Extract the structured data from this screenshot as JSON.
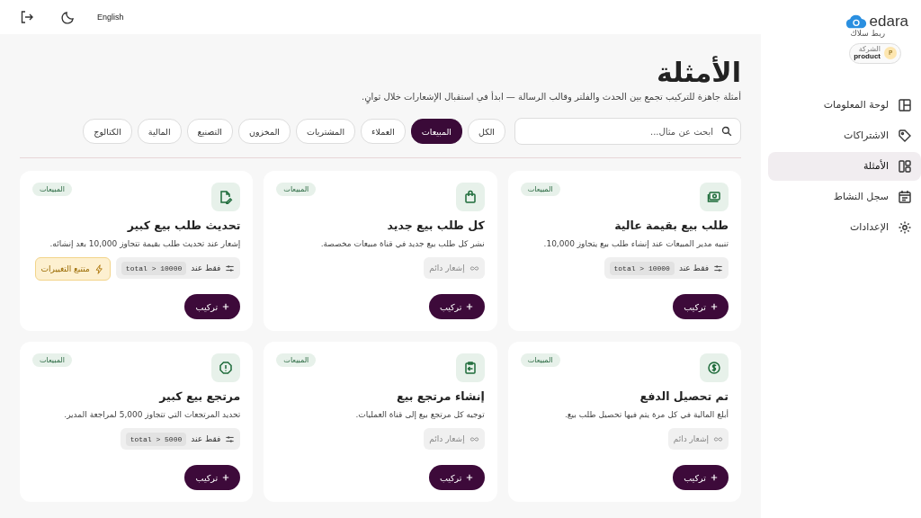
{
  "topbar": {
    "language": "English"
  },
  "brand": {
    "name": "edara",
    "subtitle": "ربط سلاك"
  },
  "company": {
    "label": "الشركة",
    "name": "product",
    "initial": "P"
  },
  "sidebar": {
    "items": [
      {
        "label": "لوحة المعلومات",
        "selected": false
      },
      {
        "label": "الاشتراكات",
        "selected": false
      },
      {
        "label": "الأمثلة",
        "selected": true
      },
      {
        "label": "سجل النشاط",
        "selected": false
      },
      {
        "label": "الإعدادات",
        "selected": false
      }
    ]
  },
  "page": {
    "title": "الأمثلة",
    "subtitle": "أمثلة جاهزة للتركيب تجمع بين الحدث والفلتر وقالب الرسالة — ابدأ في استقبال الإشعارات خلال ثوانٍ."
  },
  "search": {
    "placeholder": "ابحث عن مثال..."
  },
  "filters": [
    {
      "label": "الكل",
      "selected": false
    },
    {
      "label": "المبيعات",
      "selected": true
    },
    {
      "label": "العملاء",
      "selected": false
    },
    {
      "label": "المشتريات",
      "selected": false
    },
    {
      "label": "المخزون",
      "selected": false
    },
    {
      "label": "التصنيع",
      "selected": false
    },
    {
      "label": "المالية",
      "selected": false
    },
    {
      "label": "الكتالوج",
      "selected": false
    }
  ],
  "cards": [
    {
      "tag": "المبيعات",
      "title": "طلب بيع بقيمة عالية",
      "description": "تنبيه مدير المبيعات عند إنشاء طلب بيع يتجاوز 10,000.",
      "filter": {
        "kind": "condition",
        "label": "فقط عند",
        "code": "total > 10000"
      },
      "button": "تركيب"
    },
    {
      "tag": "المبيعات",
      "title": "كل طلب بيع جديد",
      "description": "نشر كل طلب بيع جديد في قناة مبيعات مخصصة.",
      "filter": {
        "kind": "always",
        "label": "إشعار دائم"
      },
      "button": "تركيب"
    },
    {
      "tag": "المبيعات",
      "title": "تحديث طلب بيع كبير",
      "description": "إشعار عند تحديث طلب بقيمة تتجاوز 10,000 بعد إنشائه.",
      "filter": {
        "kind": "condition",
        "label": "فقط عند",
        "code": "total > 10000"
      },
      "track_changes": "متتبع التغييرات",
      "button": "تركيب"
    },
    {
      "tag": "المبيعات",
      "title": "تم تحصيل الدفع",
      "description": "أبلغ المالية في كل مرة يتم فيها تحصيل طلب بيع.",
      "filter": {
        "kind": "always",
        "label": "إشعار دائم"
      },
      "button": "تركيب"
    },
    {
      "tag": "المبيعات",
      "title": "إنشاء مرتجع بيع",
      "description": "توجيه كل مرتجع بيع إلى قناة العمليات.",
      "filter": {
        "kind": "always",
        "label": "إشعار دائم"
      },
      "button": "تركيب"
    },
    {
      "tag": "المبيعات",
      "title": "مرتجع بيع كبير",
      "description": "تحديد المرتجعات التي تتجاوز 5,000 لمراجعة المدير.",
      "filter": {
        "kind": "condition",
        "label": "فقط عند",
        "code": "total > 5000"
      },
      "button": "تركيب"
    }
  ]
}
